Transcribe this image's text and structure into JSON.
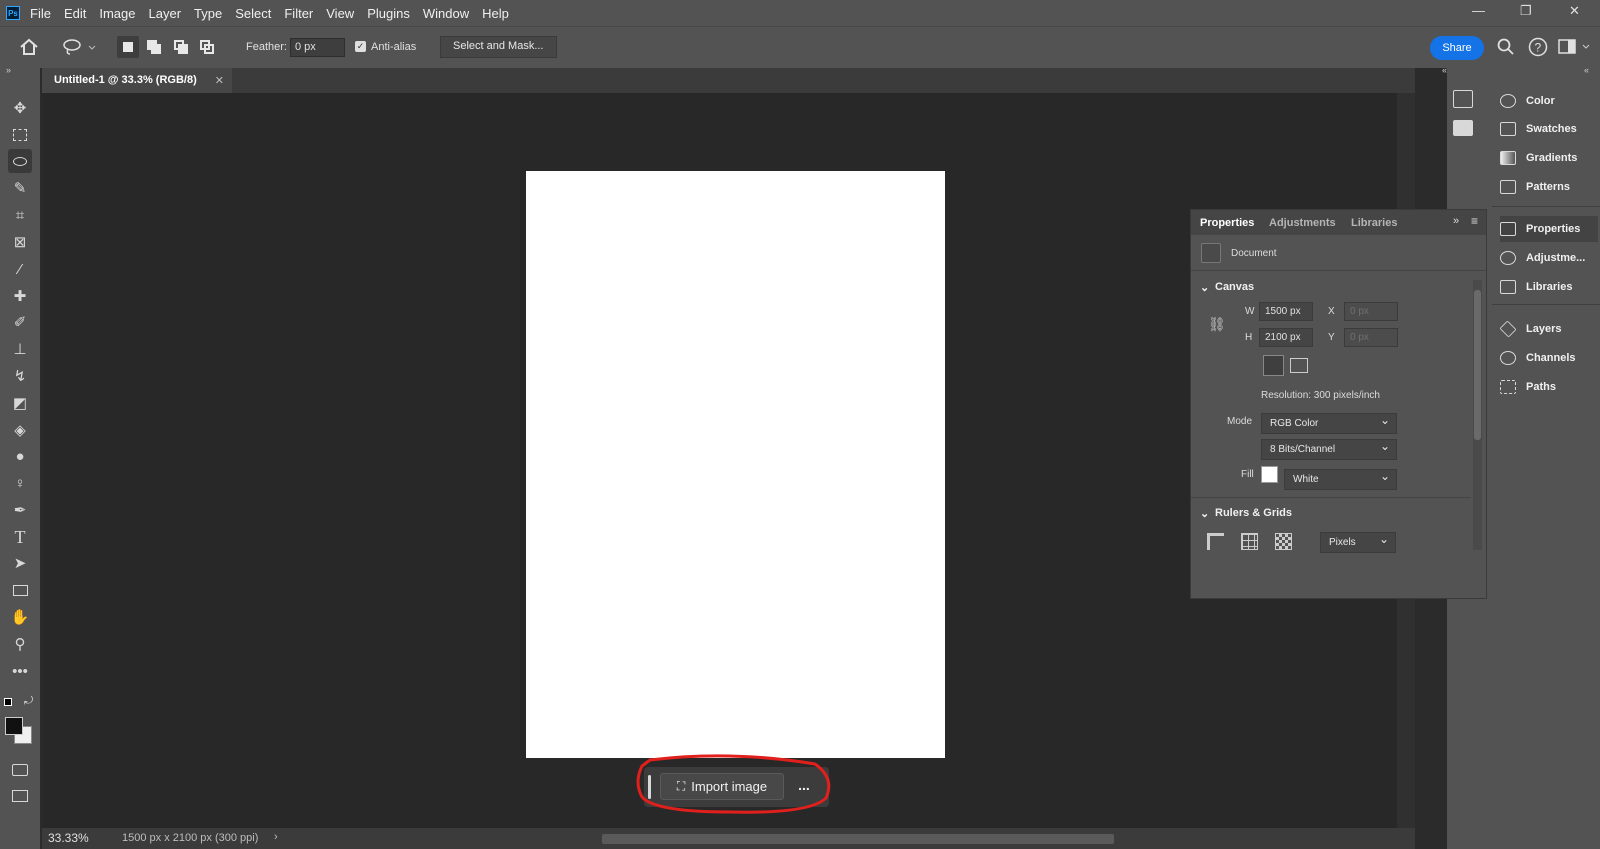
{
  "menubar": {
    "logo": "Ps",
    "items": [
      "File",
      "Edit",
      "Image",
      "Layer",
      "Type",
      "Select",
      "Filter",
      "View",
      "Plugins",
      "Window",
      "Help"
    ]
  },
  "options": {
    "feather_label": "Feather:",
    "feather_value": "0 px",
    "antialias_label": "Anti-alias",
    "select_mask_label": "Select and Mask...",
    "share_label": "Share"
  },
  "document_tab": {
    "title": "Untitled-1 @ 33.3% (RGB/8)"
  },
  "contextual_bar": {
    "import_label": "Import image",
    "more": "..."
  },
  "statusbar": {
    "zoom": "33.33%",
    "info": "1500 px x 2100 px (300 ppi)"
  },
  "properties_panel": {
    "tabs": [
      "Properties",
      "Adjustments",
      "Libraries"
    ],
    "document_label": "Document",
    "canvas_section": "Canvas",
    "w_label": "W",
    "w_value": "1500 px",
    "h_label": "H",
    "h_value": "2100 px",
    "x_label": "X",
    "x_value": "0 px",
    "y_label": "Y",
    "y_value": "0 px",
    "resolution": "Resolution: 300 pixels/inch",
    "mode_label": "Mode",
    "mode_value": "RGB Color",
    "bits_value": "8 Bits/Channel",
    "fill_label": "Fill",
    "fill_value": "White",
    "rulers_section": "Rulers & Grids",
    "units_value": "Pixels"
  },
  "dock": {
    "items": [
      "Color",
      "Swatches",
      "Gradients",
      "Patterns",
      "Properties",
      "Adjustme...",
      "Libraries",
      "Layers",
      "Channels",
      "Paths"
    ]
  },
  "colors": {
    "accent": "#1473e6",
    "highlight_ring": "#e0201c"
  }
}
